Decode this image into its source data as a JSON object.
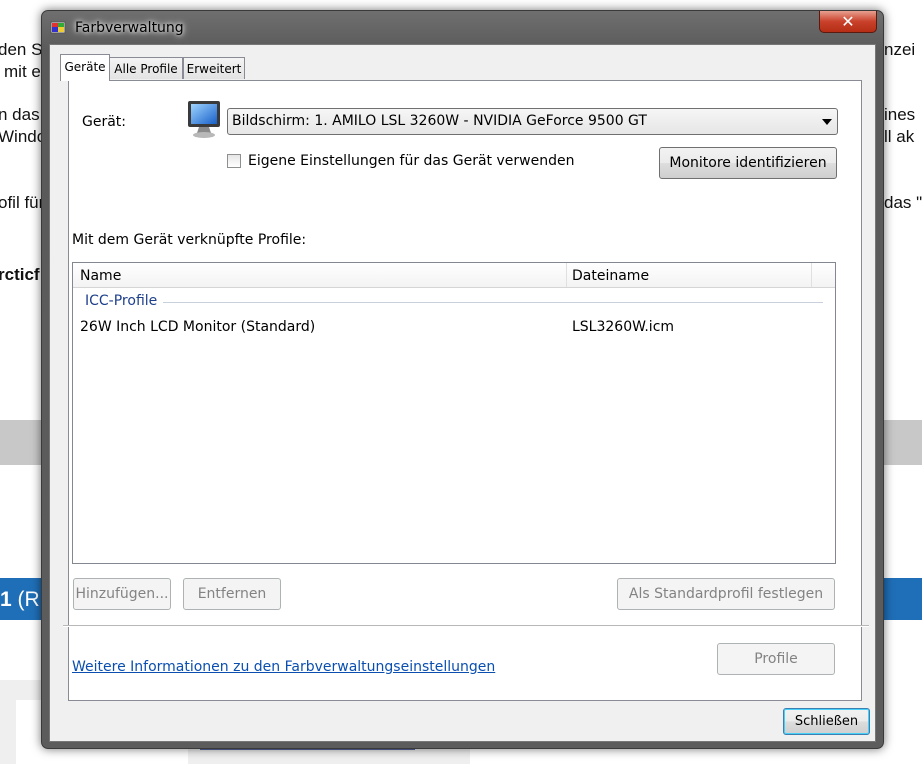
{
  "background": {
    "lines": [
      {
        "text": "den S",
        "right": "nzei"
      },
      {
        "text": "mit e",
        "right": ""
      },
      {
        "text": "n das",
        "right": "ines"
      },
      {
        "text": "Windo",
        "right": "ll ak"
      },
      {
        "text": "ofil für",
        "right": "das \""
      },
      {
        "text": "rcticf",
        "right": ""
      }
    ],
    "band_number": "1",
    "band_paren": "(R"
  },
  "window": {
    "title": "Farbverwaltung",
    "close_glyph": "✕"
  },
  "tabs": [
    {
      "label": "Geräte",
      "active": true
    },
    {
      "label": "Alle Profile",
      "active": false
    },
    {
      "label": "Erweitert",
      "active": false
    }
  ],
  "device": {
    "label": "Gerät:",
    "selected": "Bildschirm: 1. AMILO LSL 3260W - NVIDIA GeForce 9500 GT",
    "icon": "monitor-icon",
    "checkbox_label": "Eigene Einstellungen für das Gerät verwenden",
    "checkbox_checked": false,
    "identify_button": "Monitore identifizieren"
  },
  "profiles": {
    "label": "Mit dem Gerät verknüpfte Profile:",
    "columns": [
      "Name",
      "Dateiname"
    ],
    "group": "ICC-Profile",
    "rows": [
      {
        "name": "26W Inch LCD Monitor (Standard)",
        "file": "LSL3260W.icm"
      }
    ]
  },
  "buttons": {
    "add": "Hinzufügen...",
    "remove": "Entfernen",
    "set_default": "Als Standardprofil festlegen",
    "profile": "Profile",
    "close": "Schließen"
  },
  "link": "Weitere Informationen zu den Farbverwaltungseinstellungen",
  "colors": {
    "link": "#0a4fb0",
    "group": "#1e3f8c",
    "close_button": "#c9412a",
    "band_blue": "#1f6fb8"
  }
}
